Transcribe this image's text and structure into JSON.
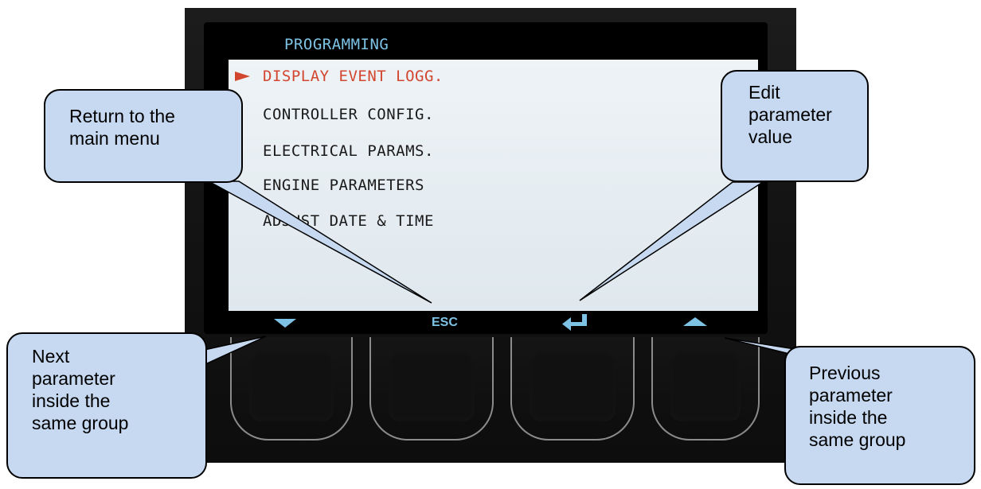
{
  "screen": {
    "title": "PROGRAMMING",
    "menu_items": [
      {
        "label": "DISPLAY EVENT LOGG.",
        "selected": true
      },
      {
        "label": "CONTROLLER CONFIG.",
        "selected": false
      },
      {
        "label": "ELECTRICAL PARAMS.",
        "selected": false
      },
      {
        "label": "ENGINE PARAMETERS",
        "selected": false
      },
      {
        "label": "ADJUST DATE & TIME",
        "selected": false
      }
    ],
    "softkeys": {
      "key1_icon": "down-triangle-icon",
      "key2_label": "ESC",
      "key3_icon": "enter-arrow-icon",
      "key4_icon": "up-triangle-icon"
    }
  },
  "callouts": {
    "return_main": "Return to the\nmain menu",
    "edit_value": "Edit\nparameter\nvalue",
    "next_param": "Next\nparameter\ninside the\nsame group",
    "prev_param": "Previous\nparameter\ninside the\nsame group"
  },
  "colors": {
    "callout_fill": "#c6d9f1",
    "screen_accent": "#7ec3e6",
    "selected_item": "#d2462f",
    "screen_bg": "#e6eef2"
  }
}
